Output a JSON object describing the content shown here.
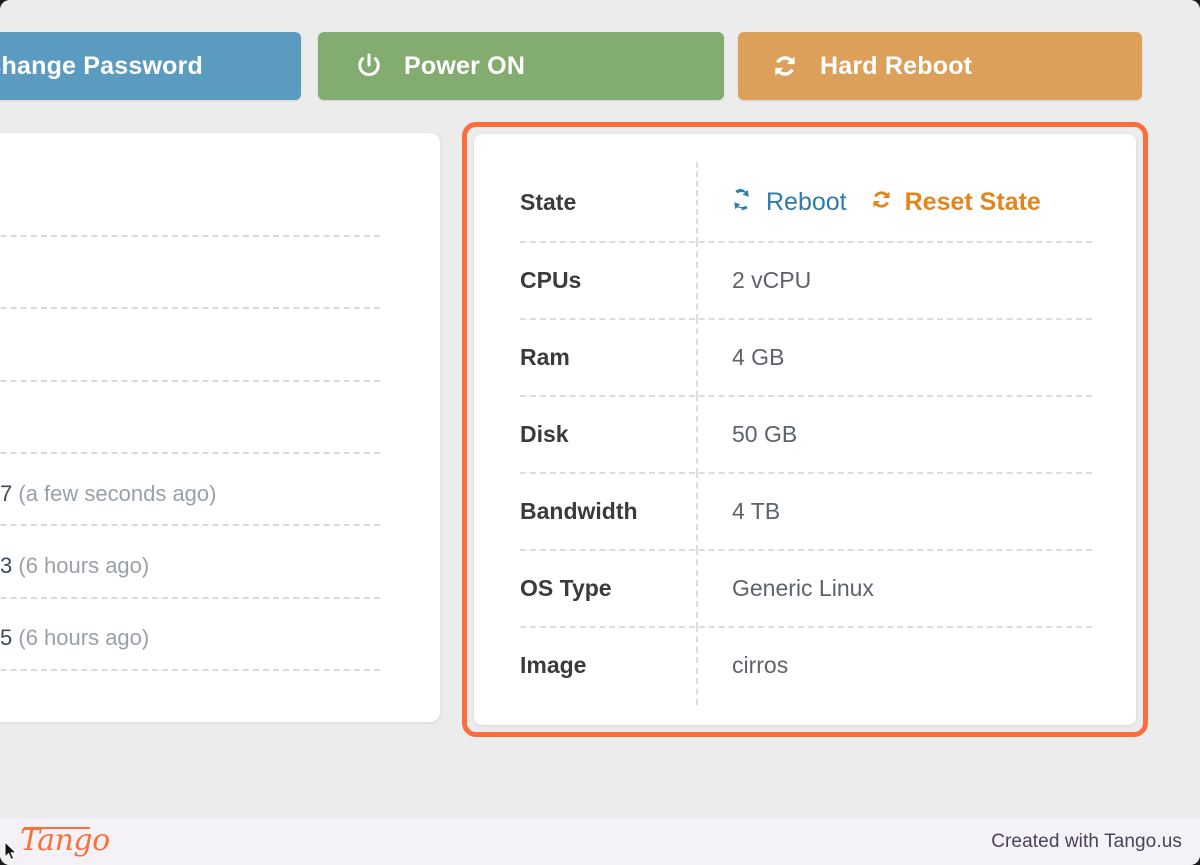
{
  "toolbar": {
    "buttons": [
      {
        "label": "Change Password",
        "icon": "",
        "color": "#5b9bc0",
        "name": "change-password-button"
      },
      {
        "label": "Power ON",
        "icon": "power-icon",
        "color": "#83ad70",
        "name": "power-on-button"
      },
      {
        "label": "Hard Reboot",
        "icon": "refresh-icon",
        "color": "#dda05b",
        "name": "hard-reboot-button"
      }
    ]
  },
  "left_card": {
    "rows": [
      {
        "value": "7",
        "relative": "(a few seconds ago)"
      },
      {
        "value": "3",
        "relative": "(6 hours ago)"
      },
      {
        "value": "5",
        "relative": "(6 hours ago)"
      }
    ]
  },
  "detail_card": {
    "highlight_color": "#fa6e3c",
    "rows": [
      {
        "label": "State",
        "value": ""
      },
      {
        "label": "CPUs",
        "value": "2 vCPU"
      },
      {
        "label": "Ram",
        "value": "4 GB"
      },
      {
        "label": "Disk",
        "value": "50 GB"
      },
      {
        "label": "Bandwidth",
        "value": "4 TB"
      },
      {
        "label": "OS Type",
        "value": "Generic Linux"
      },
      {
        "label": "Image",
        "value": "cirros"
      }
    ],
    "state_actions": [
      {
        "label": "Reboot",
        "icon": "refresh-icon",
        "color": "#2e7cab"
      },
      {
        "label": "Reset State",
        "icon": "refresh-icon",
        "color": "#e2851c"
      }
    ]
  },
  "footer": {
    "logo": "Tango",
    "credit": "Created with Tango.us"
  }
}
